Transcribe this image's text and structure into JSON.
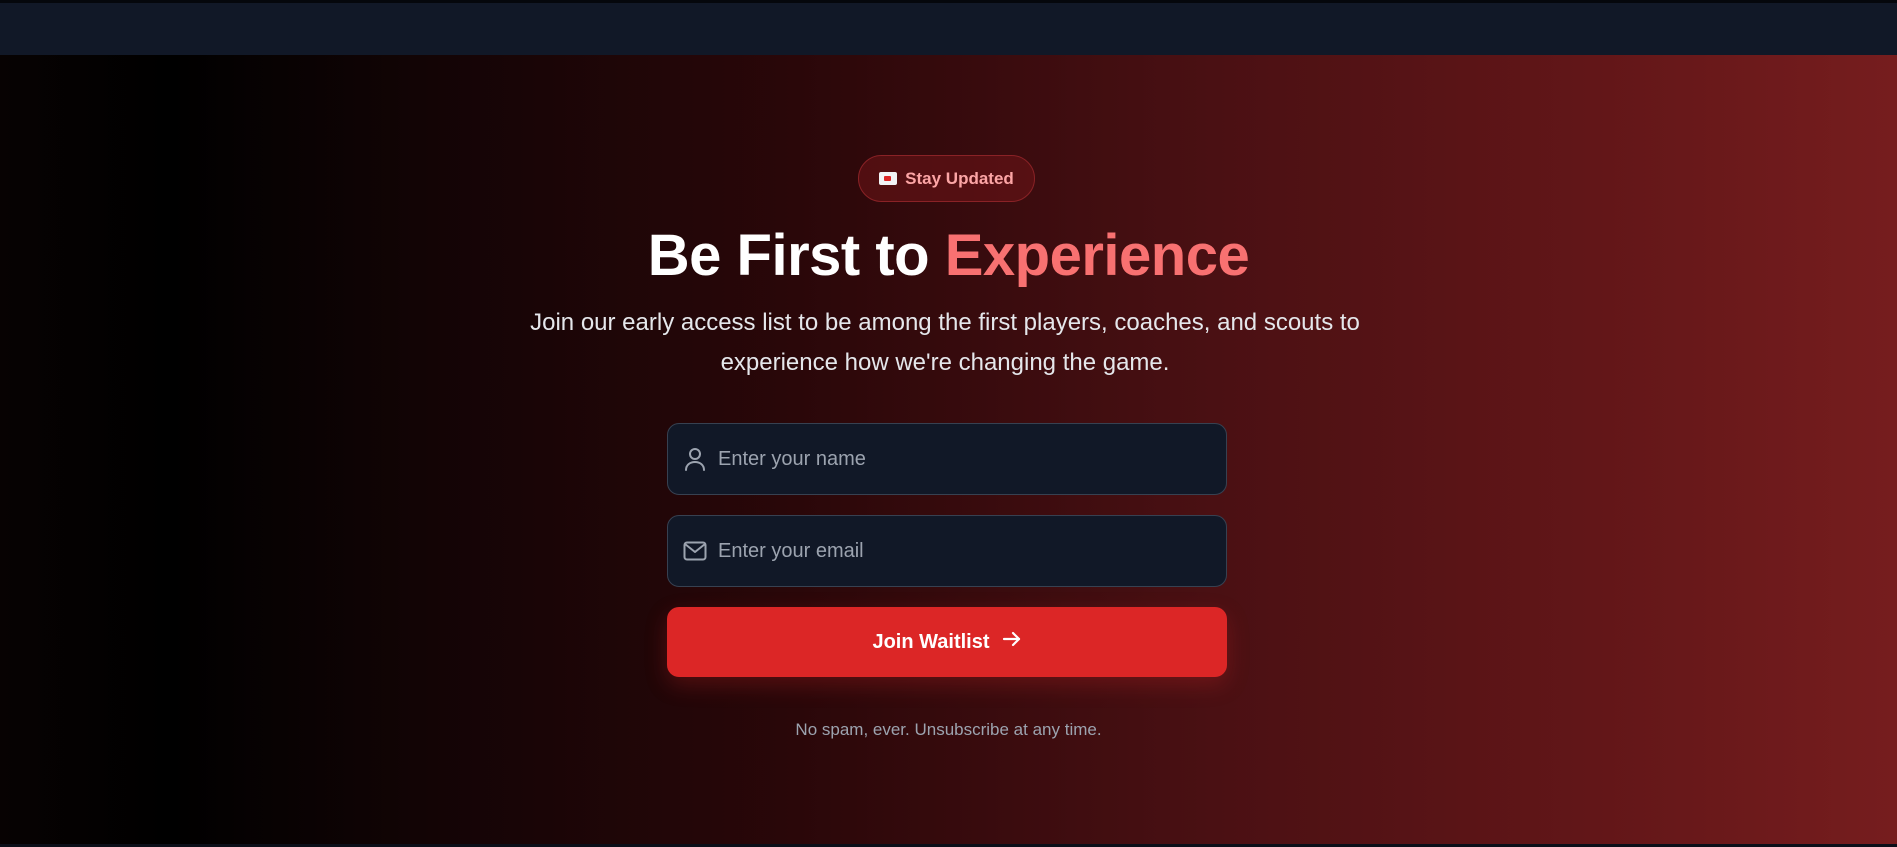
{
  "badge": {
    "icon": "envelope-emoji-icon",
    "label": "Stay Updated"
  },
  "headline": {
    "part1": "Be First to ",
    "accent": "Experience"
  },
  "subtitle": "Join our early access list to be among the first players, coaches, and scouts to experience how we're changing the game.",
  "form": {
    "name_placeholder": "Enter your name",
    "name_icon": "user-icon",
    "email_placeholder": "Enter your email",
    "email_icon": "mail-icon",
    "submit_label": "Join Waitlist",
    "submit_icon": "arrow-right-icon"
  },
  "note": "No spam, ever. Unsubscribe at any time.",
  "colors": {
    "accent": "#f87171",
    "button": "#dc2626",
    "badge_text": "#fca5a5",
    "input_bg": "#111827"
  }
}
